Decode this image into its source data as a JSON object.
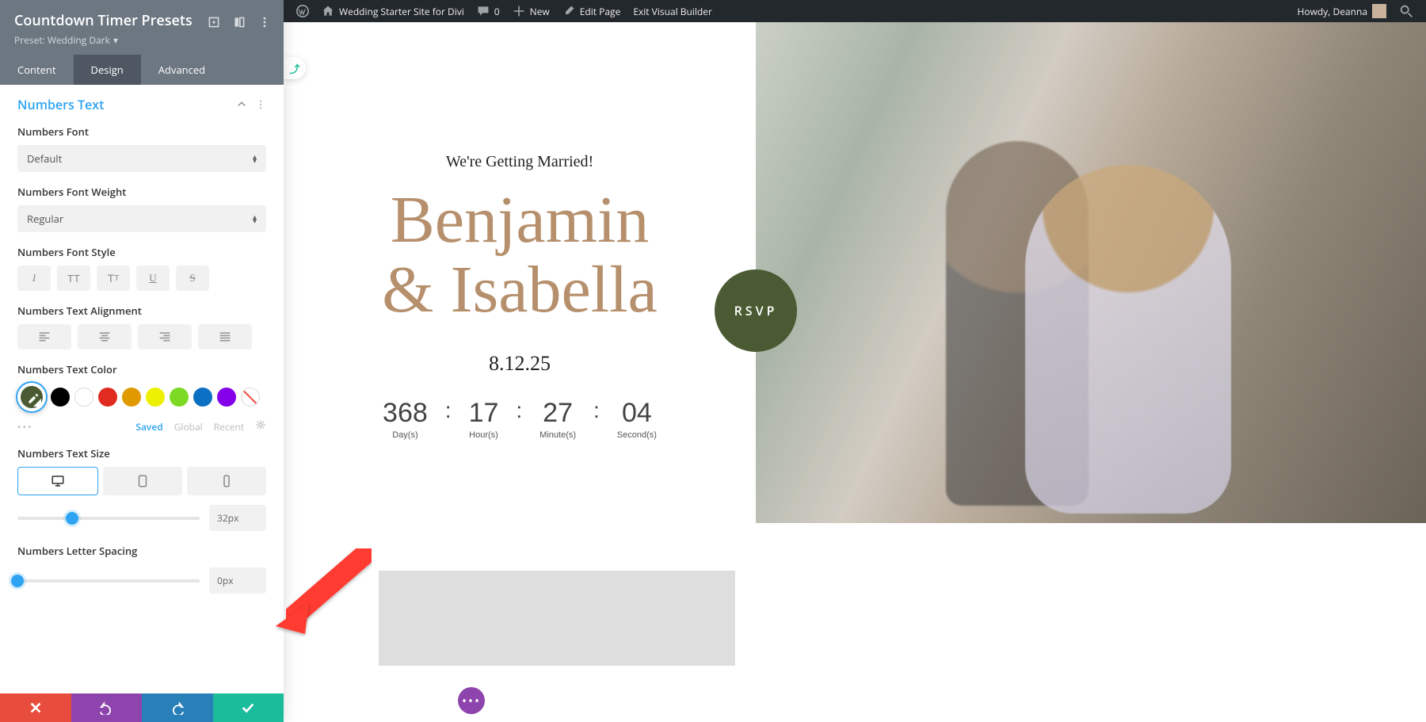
{
  "adminbar": {
    "site_name": "Wedding Starter Site for Divi",
    "comments": "0",
    "new": "New",
    "edit_page": "Edit Page",
    "exit_vb": "Exit Visual Builder",
    "howdy": "Howdy, Deanna"
  },
  "panel": {
    "title": "Countdown Timer Presets",
    "preset_label": "Preset: Wedding Dark",
    "tabs": {
      "content": "Content",
      "design": "Design",
      "advanced": "Advanced"
    },
    "group": "Numbers Text",
    "fields": {
      "font_label": "Numbers Font",
      "font_value": "Default",
      "weight_label": "Numbers Font Weight",
      "weight_value": "Regular",
      "style_label": "Numbers Font Style",
      "align_label": "Numbers Text Alignment",
      "color_label": "Numbers Text Color",
      "size_label": "Numbers Text Size",
      "size_value": "32px",
      "spacing_label": "Numbers Letter Spacing",
      "spacing_value": "0px"
    },
    "color_tabs": {
      "saved": "Saved",
      "global": "Global",
      "recent": "Recent"
    },
    "swatches": [
      "#4a5a32",
      "#000000",
      "#ffffff",
      "#e02b20",
      "#e09900",
      "#edf000",
      "#7cda24",
      "#0c71c3",
      "#8300e9"
    ]
  },
  "preview": {
    "pretitle": "We're Getting Married!",
    "names_line1": "Benjamin",
    "names_line2": "& Isabella",
    "date": "8.12.25",
    "rsvp": "RSVP",
    "countdown": {
      "days": {
        "num": "368",
        "lbl": "Day(s)"
      },
      "hours": {
        "num": "17",
        "lbl": "Hour(s)"
      },
      "minutes": {
        "num": "27",
        "lbl": "Minute(s)"
      },
      "seconds": {
        "num": "04",
        "lbl": "Second(s)"
      }
    }
  }
}
